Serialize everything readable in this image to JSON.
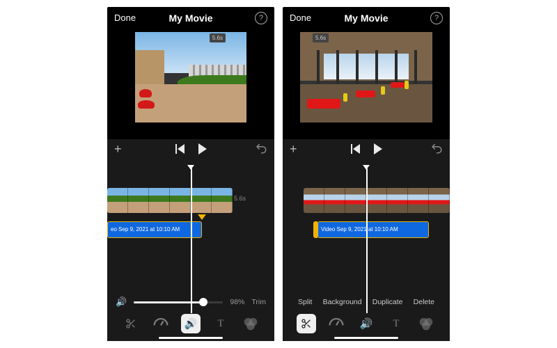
{
  "left": {
    "header": {
      "done": "Done",
      "title": "My Movie",
      "help": "?"
    },
    "preview": {
      "duration": "5.6s"
    },
    "controls": {
      "add": "+"
    },
    "timeline": {
      "clip_duration": "5.6s",
      "audio_label": "eo Sep 9, 2021 at 10:10 AM"
    },
    "volume": {
      "percent": "98%",
      "trim": "Trim"
    },
    "tools": {
      "scissors": "scissors",
      "speed": "speed",
      "audio": "audio",
      "text": "T",
      "filters": "filters"
    }
  },
  "right": {
    "header": {
      "done": "Done",
      "title": "My Movie",
      "help": "?"
    },
    "preview": {
      "duration": "5.6s"
    },
    "controls": {
      "add": "+"
    },
    "timeline": {
      "audio_label": "Video Sep 9, 2021 at 10:10 AM"
    },
    "actions": {
      "split": "Split",
      "background": "Background",
      "duplicate": "Duplicate",
      "delete": "Delete"
    },
    "tools": {
      "scissors": "scissors",
      "speed": "speed",
      "audio": "audio",
      "text": "T",
      "filters": "filters"
    }
  }
}
